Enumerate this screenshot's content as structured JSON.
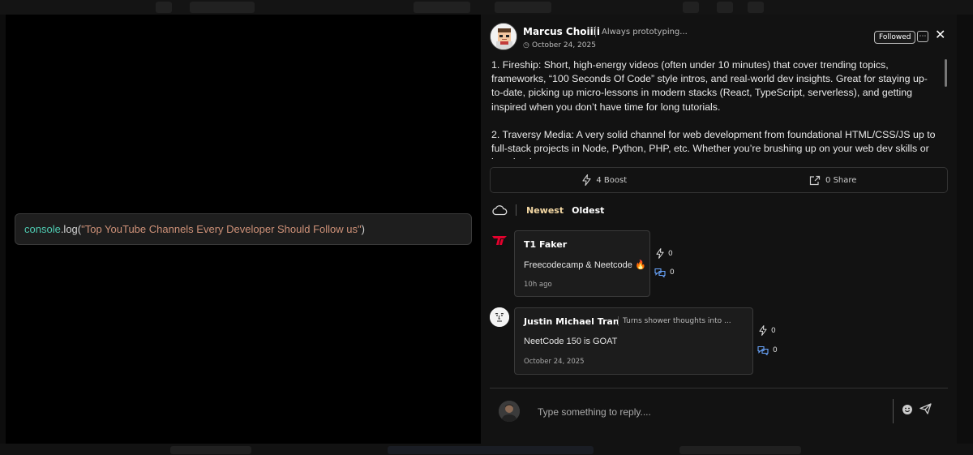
{
  "post": {
    "author_name": "Marcus Choiiii",
    "author_tagline": "Always prototyping...",
    "date": "October 24, 2025",
    "follow_label": "Followed",
    "more_icon": "more-icon",
    "close_icon": "close-icon",
    "code": {
      "fn": "console",
      "plain_a": ".log(",
      "string": "\"Top YouTube Channels Every Developer Should Follow us\"",
      "plain_b": ")"
    },
    "paragraphs": [
      "1. Fireship: Short, high-energy videos (often under 10 minutes) that cover trending topics, frameworks, “100 Seconds Of Code” style intros, and real-world dev insights. Great for staying up-to-date, picking up micro-lessons in modern stacks (React, TypeScript, serverless), and getting inspired when you don’t have time for long tutorials.",
      "2. Traversy Media: A very solid channel for web development from foundational HTML/CSS/JS up to full-stack projects in Node, Python, PHP, etc. Whether you’re brushing up on your web dev skills or jumping into"
    ],
    "boost_label": "4 Boost",
    "share_label": "0 Share"
  },
  "sort": {
    "newest": "Newest",
    "oldest": "Oldest",
    "active": "newest"
  },
  "comments": [
    {
      "name": "T1 Faker",
      "text": "Freecodecamp & Neetcode",
      "emoji": "🔥",
      "time": "10h ago",
      "boosts": "0",
      "replies": "0"
    },
    {
      "name": "Justin Michael Tran",
      "tagline": "Turns shower thoughts into ...",
      "text": "NeetCode 150 is GOAT",
      "time": "October 24, 2025",
      "boosts": "0",
      "replies": "0"
    }
  ],
  "reply": {
    "placeholder": "Type something to reply...."
  },
  "colors": {
    "accent_tab": "#f3d7a3",
    "faker_brand": "#e2012d"
  }
}
